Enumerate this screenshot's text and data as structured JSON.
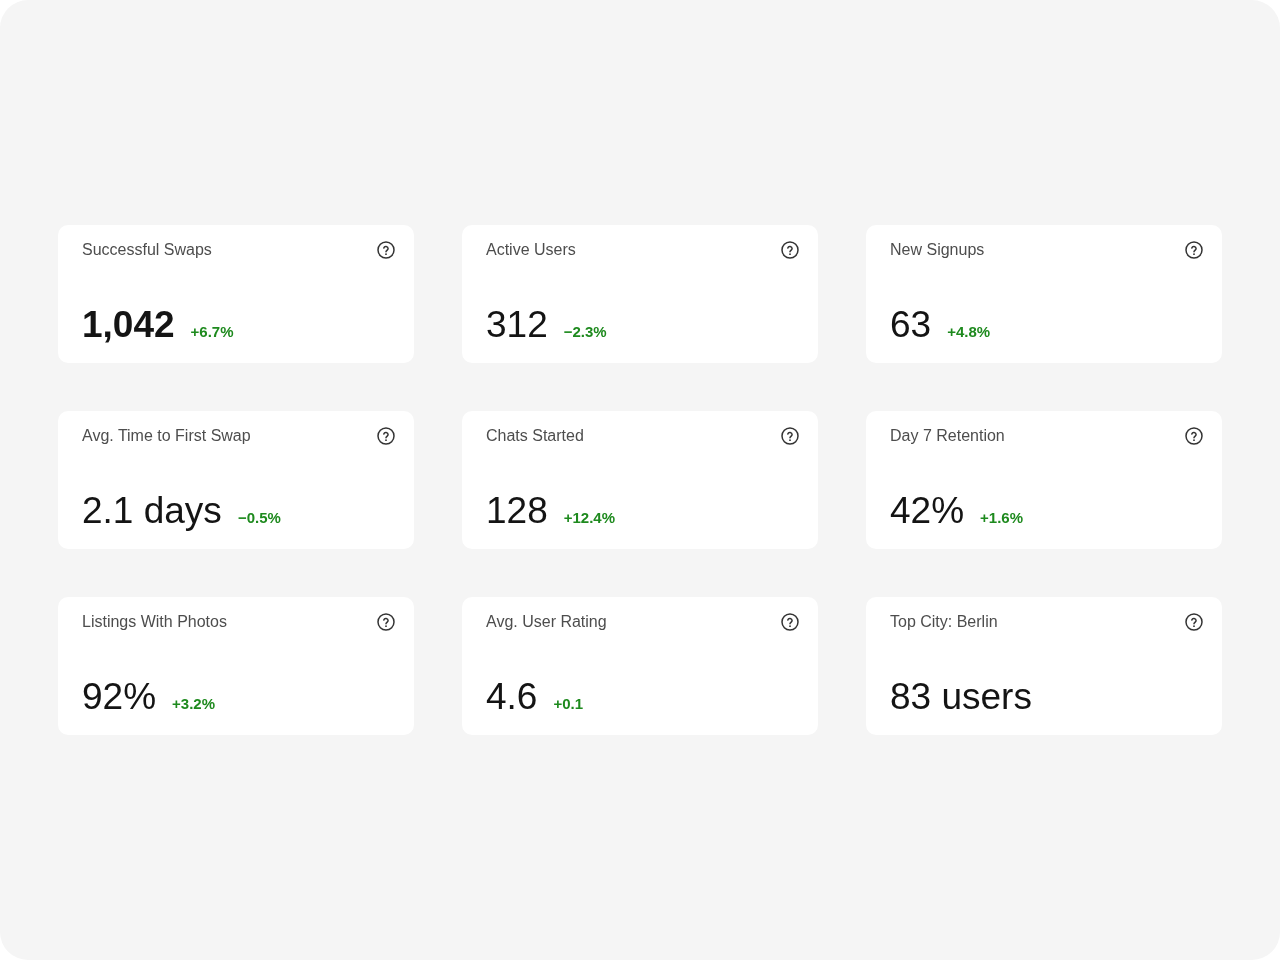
{
  "metrics": [
    {
      "title": "Successful Swaps",
      "value": "1,042",
      "bold": true,
      "change": "+6.7%"
    },
    {
      "title": "Active Users",
      "value": "312",
      "bold": false,
      "change": "−2.3%"
    },
    {
      "title": "New Signups",
      "value": "63",
      "bold": false,
      "change": "+4.8%"
    },
    {
      "title": "Avg. Time to First Swap",
      "value": "2.1 days",
      "bold": false,
      "change": "−0.5%"
    },
    {
      "title": "Chats Started",
      "value": "128",
      "bold": false,
      "change": "+12.4%"
    },
    {
      "title": "Day 7 Retention",
      "value": "42%",
      "bold": false,
      "change": "+1.6%"
    },
    {
      "title": "Listings With Photos",
      "value": "92%",
      "bold": false,
      "change": "+3.2%"
    },
    {
      "title": "Avg. User Rating",
      "value": "4.6",
      "bold": false,
      "change": "+0.1"
    },
    {
      "title": "Top City: Berlin",
      "value": "83 users",
      "bold": false
    }
  ]
}
